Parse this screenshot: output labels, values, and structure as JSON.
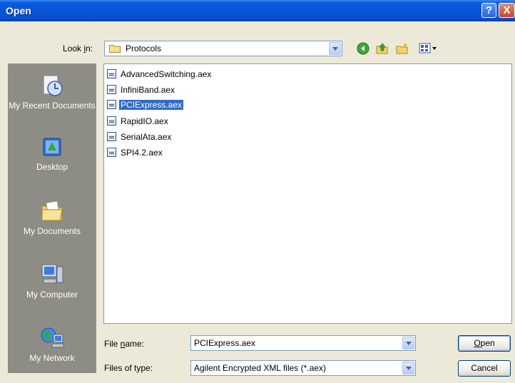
{
  "window": {
    "title": "Open",
    "help_label": "?",
    "close_label": "X"
  },
  "lookin": {
    "label_pre": "Look ",
    "label_key": "i",
    "label_post": "n:",
    "value": "Protocols"
  },
  "toolbar": {
    "icons": [
      "back-icon",
      "up-folder-icon",
      "new-folder-icon",
      "views-menu-icon"
    ]
  },
  "places": [
    {
      "label": "My Recent Documents",
      "icon": "recent-documents-icon"
    },
    {
      "label": "Desktop",
      "icon": "desktop-icon"
    },
    {
      "label": "My Documents",
      "icon": "my-documents-icon"
    },
    {
      "label": "My Computer",
      "icon": "my-computer-icon"
    },
    {
      "label": "My Network",
      "icon": "my-network-icon"
    }
  ],
  "files": [
    {
      "name": "AdvancedSwitching.aex",
      "selected": false
    },
    {
      "name": "InfiniBand.aex",
      "selected": false
    },
    {
      "name": "PCIExpress.aex",
      "selected": true
    },
    {
      "name": "RapidIO.aex",
      "selected": false
    },
    {
      "name": "SerialAta.aex",
      "selected": false
    },
    {
      "name": "SPI4.2.aex",
      "selected": false
    }
  ],
  "filename": {
    "label_pre": "File ",
    "label_key": "n",
    "label_post": "ame:",
    "value": "PCIExpress.aex"
  },
  "filetype": {
    "label": "Files of type:",
    "value": "Agilent Encrypted XML files (*.aex)"
  },
  "buttons": {
    "open_key": "O",
    "open_rest": "pen",
    "cancel": "Cancel"
  },
  "colors": {
    "title_bar": "#0853d6",
    "selection": "#316ac5",
    "dialog_bg": "#ece9d8"
  }
}
